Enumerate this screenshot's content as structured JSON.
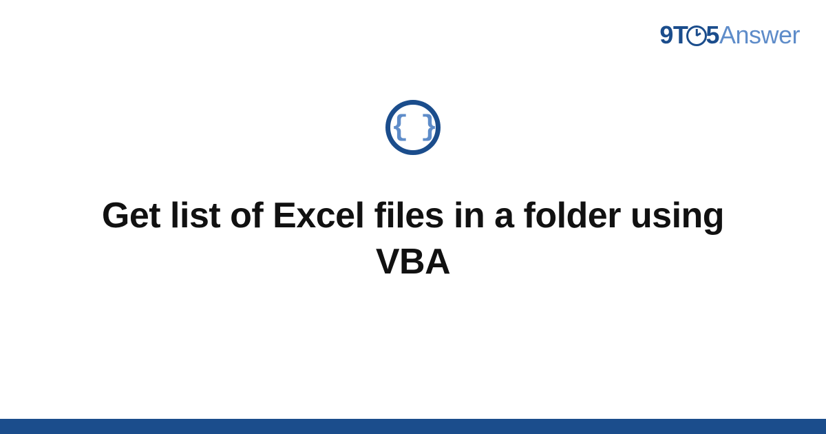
{
  "brand": {
    "nine": "9",
    "t": "T",
    "five": "5",
    "answer": "Answer"
  },
  "icon": {
    "braces": "{ }"
  },
  "title": "Get list of Excel files in a folder using VBA"
}
